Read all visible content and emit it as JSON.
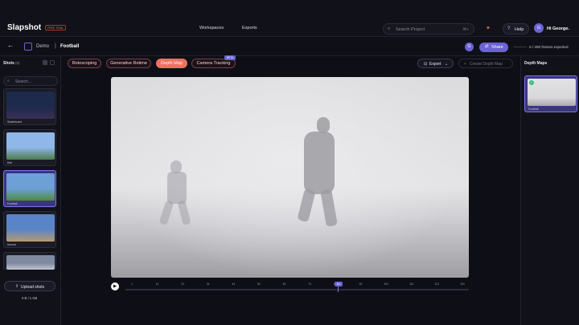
{
  "app": {
    "logo": "Slapshot",
    "badge": "FREE TRIAL",
    "nav": [
      "Workspaces",
      "Exports"
    ],
    "search_placeholder": "Search Project",
    "search_shortcut": "⌘+",
    "help_label": "Help",
    "avatar_initial": "G",
    "greeting": "Hi George"
  },
  "crumbs": {
    "project": "Demo",
    "shot": "Football",
    "user_initial": "G",
    "share_label": "Share",
    "frames_exported": "0 / 250 frames exported"
  },
  "toolbar": {
    "tabs": [
      "Rotoscoping",
      "Generative Retime",
      "Depth Map",
      "Camera Tracking"
    ],
    "active_tab": "Depth Map",
    "new_badge": "BETA",
    "export_label": "Export",
    "create_label": "Create Depth Map"
  },
  "shots": {
    "title": "Shots",
    "count": "(5)",
    "search_placeholder": "Search...",
    "items": [
      {
        "name": "Skateboard",
        "colors": [
          "#1c2a4c",
          "#3b2f55"
        ]
      },
      {
        "name": "Kite",
        "colors": [
          "#8fb8e8",
          "#4c7a4a"
        ]
      },
      {
        "name": "Football",
        "colors": [
          "#6ea0d8",
          "#4f8a3d"
        ]
      },
      {
        "name": "Sunset",
        "colors": [
          "#5a84c8",
          "#b89a6e"
        ]
      },
      {
        "name": "",
        "colors": [
          "#7f8aa0",
          "#c0c6d2"
        ]
      }
    ],
    "active": "Football",
    "upload_label": "Upload shots",
    "total": "0 B / 1 GB"
  },
  "timeline": {
    "ticks": [
      "1",
      "11",
      "21",
      "31",
      "41",
      "51",
      "61",
      "71",
      "81",
      "91",
      "101",
      "111",
      "121",
      "131"
    ],
    "current_frame": "84",
    "current_fraction": 0.62
  },
  "depth_panel": {
    "title": "Depth Maps",
    "item_name": "Football"
  },
  "colors": {
    "accent": "#6b63d6",
    "active_tab": "#f07060",
    "background": "#0e0f16"
  }
}
